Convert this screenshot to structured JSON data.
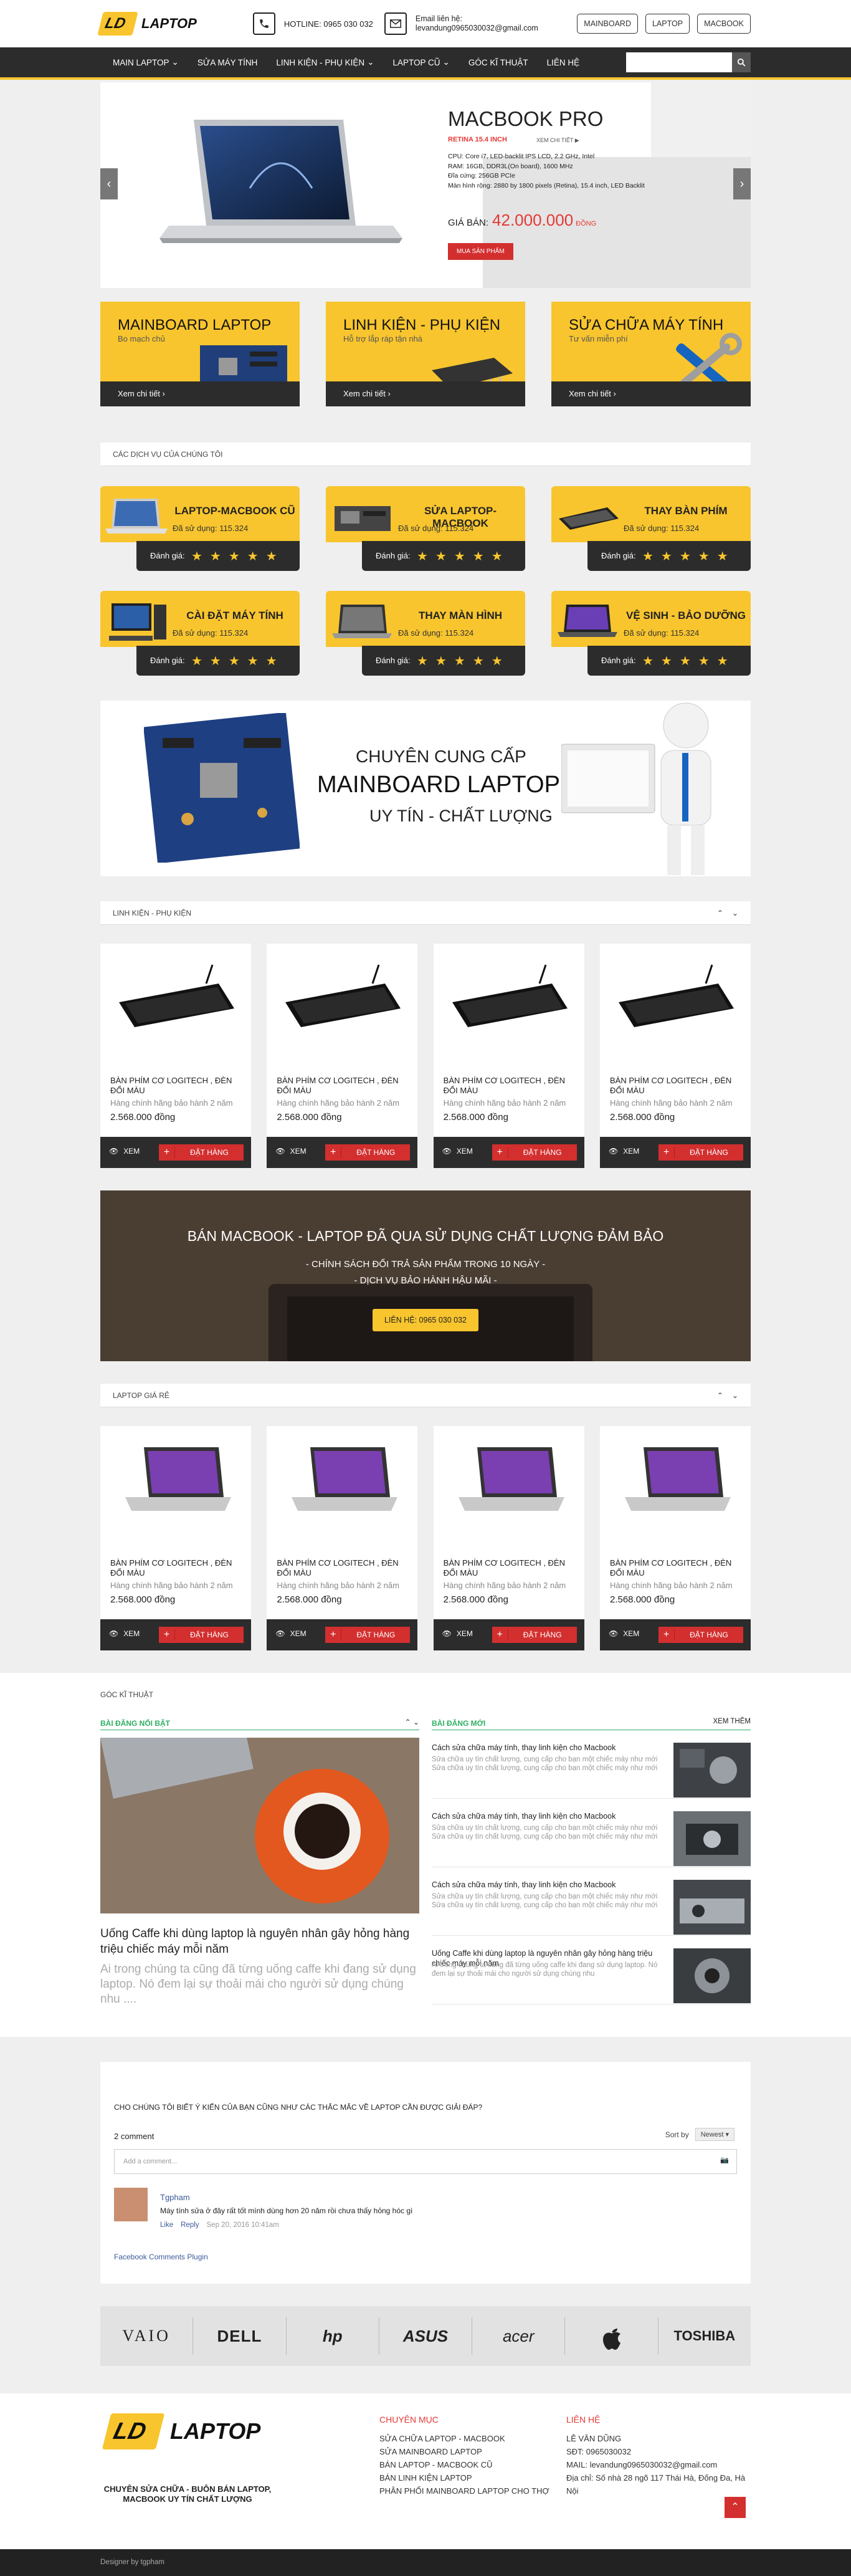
{
  "header": {
    "logo_badge": "LD",
    "logo_text": "LAPTOP",
    "hotline": "HOTLINE: 0965 030 032",
    "email_label": "Email liên hệ:",
    "email": "levandung0965030032@gmail.com",
    "buttons": [
      "MAINBOARD",
      "LAPTOP",
      "MACBOOK"
    ]
  },
  "nav": {
    "items": [
      {
        "label": "MAIN LAPTOP",
        "dropdown": true
      },
      {
        "label": "SỬA MÁY TÍNH",
        "dropdown": false
      },
      {
        "label": "LINH KIỆN - PHỤ KIỆN",
        "dropdown": true
      },
      {
        "label": "LAPTOP CŨ",
        "dropdown": true
      },
      {
        "label": "GÓC KĨ THUẬT",
        "dropdown": false
      },
      {
        "label": "LIÊN HỆ",
        "dropdown": false
      }
    ],
    "search_placeholder": ""
  },
  "slider": {
    "title": "MACBOOK PRO",
    "subtitle": "RETINA 15.4 INCH",
    "detail_link": "XEM CHI TIẾT",
    "specs": [
      "CPU: Core i7, LED-backlit IPS LCD, 2.2 GHz, Intel",
      "RAM: 16GB, DDR3L(On board), 1600 MHz",
      "Đĩa cứng: 256GB PCIe",
      "Màn hình rộng: 2880 by 1800 pixels (Retina), 15.4 inch, LED Backlit"
    ],
    "price_label": "GIÁ BÁN:",
    "price": "42.000.000",
    "currency": "ĐỒNG",
    "buy": "MUA SẢN PHẨM"
  },
  "banners": [
    {
      "title": "MAINBOARD LAPTOP",
      "sub": "Bo mạch chủ",
      "link": "Xem chi tiết"
    },
    {
      "title": "LINH KIỆN - PHỤ KIỆN",
      "sub": "Hỗ trợ lắp ráp tận nhà",
      "link": "Xem chi tiết"
    },
    {
      "title": "SỬA CHỮA MÁY TÍNH",
      "sub": "Tư vấn miễn phí",
      "link": "Xem chi tiết"
    }
  ],
  "services_heading": "CÁC DỊCH VỤ CỦA CHÚNG TÔI",
  "services": [
    {
      "name": "LAPTOP-MACBOOK CŨ",
      "used": "Đã sử dụng: 115.324",
      "rating_label": "Đánh giá:",
      "stars": "★★★★★"
    },
    {
      "name": "SỬA LAPTOP-MACBOOK",
      "used": "Đã sử dụng: 115.324",
      "rating_label": "Đánh giá:",
      "stars": "★★★★★"
    },
    {
      "name": "THAY BÀN PHÍM",
      "used": "Đã sử dụng: 115.324",
      "rating_label": "Đánh giá:",
      "stars": "★★★★★"
    },
    {
      "name": "CÀI ĐẶT MÁY TÍNH",
      "used": "Đã sử dụng: 115.324",
      "rating_label": "Đánh giá:",
      "stars": "★★★★★"
    },
    {
      "name": "THAY MÀN HÌNH",
      "used": "Đã sử dụng: 115.324",
      "rating_label": "Đánh giá:",
      "stars": "★★★★★"
    },
    {
      "name": "VỆ SINH - BẢO DƯỠNG",
      "used": "Đã sử dụng: 115.324",
      "rating_label": "Đánh giá:",
      "stars": "★★★★★"
    }
  ],
  "mainboard_ad": {
    "line1": "CHUYÊN CUNG CẤP",
    "line2": "MAINBOARD LAPTOP",
    "line3": "UY TÍN - CHẤT LƯỢNG"
  },
  "accessories_heading": "LINH KIỆN - PHỤ KIỆN",
  "accessories": [
    {
      "name": "BÀN PHÍM CƠ LOGITECH , ĐÈN ĐỔI MÀU",
      "warranty": "Hàng chính hãng bảo hành 2 năm",
      "price": "2.568.000 đồng",
      "view": "XEM",
      "order": "ĐẶT HÀNG"
    },
    {
      "name": "BÀN PHÍM CƠ LOGITECH , ĐÈN ĐỔI MÀU",
      "warranty": "Hàng chính hãng bảo hành 2 năm",
      "price": "2.568.000 đồng",
      "view": "XEM",
      "order": "ĐẶT HÀNG"
    },
    {
      "name": "BÀN PHÍM CƠ LOGITECH , ĐÈN ĐỔI MÀU",
      "warranty": "Hàng chính hãng bảo hành 2 năm",
      "price": "2.568.000 đồng",
      "view": "XEM",
      "order": "ĐẶT HÀNG"
    },
    {
      "name": "BÀN PHÍM CƠ LOGITECH , ĐÈN ĐỔI MÀU",
      "warranty": "Hàng chính hãng bảo hành 2 năm",
      "price": "2.568.000 đồng",
      "view": "XEM",
      "order": "ĐẶT HÀNG"
    }
  ],
  "macbook_ad": {
    "heading": "BÁN MACBOOK - LAPTOP ĐÃ QUA SỬ DỤNG CHẤT LƯỢNG ĐẢM BẢO",
    "line1": "- CHÍNH SÁCH ĐỔI TRẢ SẢN PHẨM TRONG 10 NGÀY -",
    "line2": "- DỊCH VỤ BẢO HÀNH HẬU MÃI -",
    "button": "LIÊN HỆ: 0965 030 032"
  },
  "laptops_heading": "LAPTOP GIÁ RẺ",
  "laptops": [
    {
      "name": "BÀN PHÍM CƠ LOGITECH , ĐÈN ĐỔI MÀU",
      "warranty": "Hàng chính hãng bảo hành 2 năm",
      "price": "2.568.000 đồng",
      "view": "XEM",
      "order": "ĐẶT HÀNG"
    },
    {
      "name": "BÀN PHÍM CƠ LOGITECH , ĐÈN ĐỔI MÀU",
      "warranty": "Hàng chính hãng bảo hành 2 năm",
      "price": "2.568.000 đồng",
      "view": "XEM",
      "order": "ĐẶT HÀNG"
    },
    {
      "name": "BÀN PHÍM CƠ LOGITECH , ĐÈN ĐỔI MÀU",
      "warranty": "Hàng chính hãng bảo hành 2 năm",
      "price": "2.568.000 đồng",
      "view": "XEM",
      "order": "ĐẶT HÀNG"
    },
    {
      "name": "BÀN PHÍM CƠ LOGITECH , ĐÈN ĐỔI MÀU",
      "warranty": "Hàng chính hãng bảo hành 2 năm",
      "price": "2.568.000 đồng",
      "view": "XEM",
      "order": "ĐẶT HÀNG"
    }
  ],
  "kithuat": {
    "heading": "GÓC KĨ THUẬT",
    "featured_label": "BÀI ĐĂNG NỔI BẬT",
    "featured_title": "Uống Caffe khi dùng laptop là nguyên nhân gây hỏng hàng triệu chiếc máy mỗi năm",
    "featured_desc": "Ai trong chúng ta cũng đã từng uống caffe khi đang sử dụng laptop. Nó đem lại sự thoải mái cho người sử dụng chúng nhu ....",
    "new_label": "BÀI ĐĂNG MỚI",
    "more": "XEM THÊM",
    "posts": [
      {
        "title": "Cách sửa chữa máy tính, thay linh kiện cho Macbook",
        "desc": "Sửa chữa uy tín chất lượng, cung cấp cho bạn một chiếc máy như mới Sửa chữa uy tín chất lượng, cung cấp cho bạn một chiếc máy như mới"
      },
      {
        "title": "Cách sửa chữa máy tính, thay linh kiện cho Macbook",
        "desc": "Sửa chữa uy tín chất lượng, cung cấp cho bạn một chiếc máy như mới Sửa chữa uy tín chất lượng, cung cấp cho bạn một chiếc máy như mới"
      },
      {
        "title": "Cách sửa chữa máy tính, thay linh kiện cho Macbook",
        "desc": "Sửa chữa uy tín chất lượng, cung cấp cho bạn một chiếc máy như mới Sửa chữa uy tín chất lượng, cung cấp cho bạn một chiếc máy như mới"
      },
      {
        "title": "Uống Caffe khi dùng laptop là nguyên nhân gây hỏng hàng triệu chiếc máy mỗi năm",
        "desc": "Ai trong chúng ta cũng đã từng uống caffe khi đang sử dụng laptop. Nó đem lại sự thoải mái cho người sử dụng chúng nhu"
      }
    ]
  },
  "comments": {
    "question": "CHO CHÚNG TÔI BIẾT Ý KIẾN CỦA BẠN CŨNG NHƯ CÁC THẮC MẮC VỀ LAPTOP CẦN ĐƯỢC GIẢI ĐÁP?",
    "count": "2 comment",
    "sort_label": "Sort by",
    "sort_value": "Newest",
    "add_placeholder": "Add a comment...",
    "user": "Tgpham",
    "text": "Máy tính sửa ở đây rất tốt mình dùng hơn 20 năm rồi chưa thấy hỏng hóc gì",
    "like": "Like",
    "reply": "Reply",
    "time": "Sep 20, 2016 10:41am",
    "plugin": "Facebook Comments Plugin"
  },
  "brands": [
    "VAIO",
    "DELL",
    "hp",
    "ASUS",
    "acer",
    "",
    "TOSHIBA"
  ],
  "footer": {
    "slogan": "CHUYÊN SỬA CHỮA - BUÔN BÁN LAPTOP, MACBOOK UY TÍN CHẤT LƯỢNG",
    "col1_title": "CHUYÊN MỤC",
    "col1_items": [
      "SỬA CHỮA LAPTOP - MACBOOK",
      "SỬA MAINBOARD LAPTOP",
      "BÁN LAPTOP - MACBOOK CŨ",
      "BÁN LINH KIỆN LAPTOP",
      "PHÂN PHỐI MAINBOARD LAPTOP CHO THỢ"
    ],
    "col2_title": "LIÊN HỆ",
    "col2_items": [
      "LÊ VĂN DŨNG",
      "SĐT: 0965030032",
      "MAIL: levandung0965030032@gmail.com",
      "Địa chỉ: Số nhà 28 ngõ 117 Thái Hà, Đống Đa, Hà Nội"
    ]
  },
  "bottom": "Designer by tgpham",
  "colors": {
    "accent": "#f8c52e",
    "dark": "#2c2c2c",
    "red": "#d32f2f",
    "green": "#2eaf63"
  }
}
